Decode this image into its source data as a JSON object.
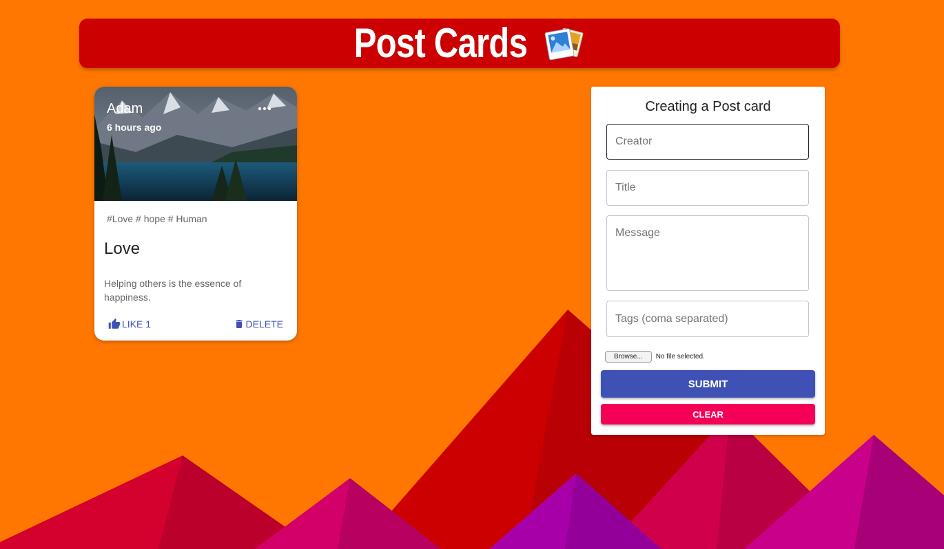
{
  "header": {
    "title": "Post Cards",
    "icon": "photos-icon"
  },
  "posts": [
    {
      "creator": "Adam",
      "time": "6 hours ago",
      "tags": "#Love # hope # Human",
      "title": "Love",
      "message": "Helping others is the essence of happiness.",
      "like_label": "LIKE 1",
      "delete_label": "DELETE"
    }
  ],
  "form": {
    "heading": "Creating a Post card",
    "creator_placeholder": "Creator",
    "title_placeholder": "Title",
    "message_placeholder": "Message",
    "tags_placeholder": "Tags (coma separated)",
    "browse_label": "Browse...",
    "file_status": "No file selected.",
    "submit_label": "SUBMIT",
    "clear_label": "CLEAR"
  },
  "colors": {
    "background": "#ff7700",
    "app_bar": "#cc0000",
    "primary": "#3f51b5",
    "secondary": "#f50057"
  }
}
